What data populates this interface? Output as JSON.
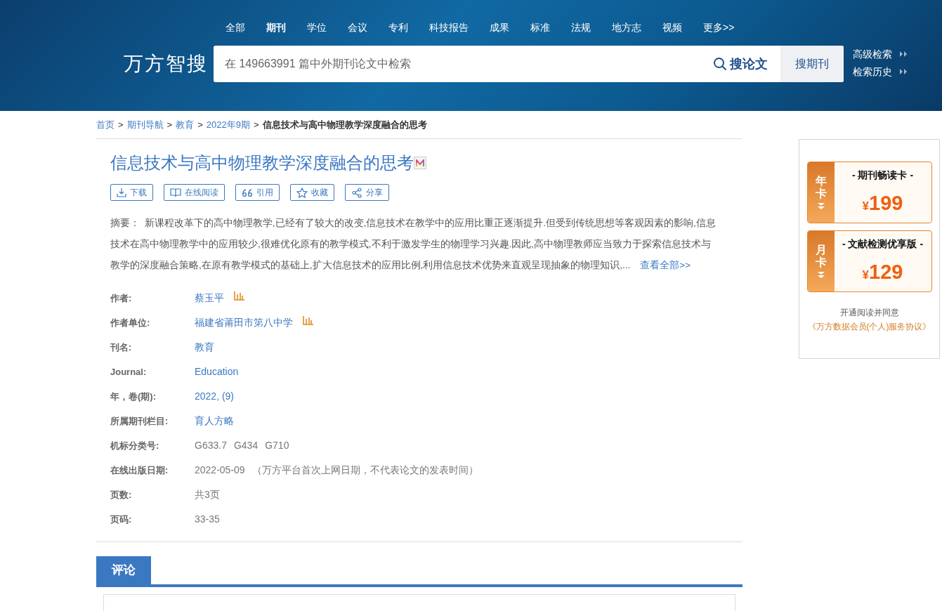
{
  "nav": [
    {
      "label": "全部",
      "selected": false
    },
    {
      "label": "期刊",
      "selected": true
    },
    {
      "label": "学位",
      "selected": false
    },
    {
      "label": "会议",
      "selected": false
    },
    {
      "label": "专利",
      "selected": false
    },
    {
      "label": "科技报告",
      "selected": false
    },
    {
      "label": "成果",
      "selected": false
    },
    {
      "label": "标准",
      "selected": false
    },
    {
      "label": "法规",
      "selected": false
    },
    {
      "label": "地方志",
      "selected": false
    },
    {
      "label": "视频",
      "selected": false
    },
    {
      "label": "更多>>",
      "selected": false
    }
  ],
  "logo": "万方智搜",
  "search": {
    "placeholder": "在 149663991 篇中外期刊论文中检索",
    "primary_button": "搜论文",
    "secondary_button": "搜期刊"
  },
  "side_links": [
    "高级检索",
    "检索历史"
  ],
  "breadcrumb_separator": ">",
  "breadcrumb": [
    {
      "label": "首页",
      "current": false
    },
    {
      "label": "期刊导航",
      "current": false
    },
    {
      "label": "教育",
      "current": false
    },
    {
      "label": "2022年9期",
      "current": false
    },
    {
      "label": "信息技术与高中物理教学深度融合的思考",
      "current": true
    }
  ],
  "title": "信息技术与高中物理教学深度融合的思考",
  "actions": [
    {
      "kind": "download",
      "label": "下载"
    },
    {
      "kind": "read",
      "label": "在线阅读"
    },
    {
      "kind": "cite",
      "label": "引用"
    },
    {
      "kind": "favorite",
      "label": "收藏"
    },
    {
      "kind": "share",
      "label": "分享"
    }
  ],
  "abstract": {
    "label": "摘要：",
    "text": "新课程改革下的高中物理教学,已经有了较大的改变,信息技术在教学中的应用比重正逐渐提升.但受到传统思想等客观因素的影响,信息技术在高中物理教学中的应用较少,很难优化原有的教学模式,不利于激发学生的物理学习兴趣.因此,高中物理教师应当致力于探索信息技术与教学的深度融合策略,在原有教学模式的基础上,扩大信息技术的应用比例,利用信息技术优势来直观呈现抽象的物理知识,...",
    "more": "查看全部>>"
  },
  "fields": [
    {
      "label": "作者:",
      "kind": "link",
      "values": [
        "蔡玉平"
      ],
      "stats": true
    },
    {
      "label": "作者单位:",
      "kind": "link",
      "values": [
        "福建省莆田市第八中学"
      ],
      "stats": true
    },
    {
      "label": "刊名:",
      "kind": "link",
      "values": [
        "教育"
      ],
      "stats": false
    },
    {
      "label": "Journal:",
      "kind": "link",
      "values": [
        "Education"
      ],
      "stats": false
    },
    {
      "label": "年，卷(期):",
      "kind": "link",
      "values": [
        "2022, (9)"
      ],
      "stats": false
    },
    {
      "label": "所属期刊栏目:",
      "kind": "link",
      "values": [
        "育人方略"
      ],
      "stats": false
    },
    {
      "label": "机标分类号:",
      "kind": "text",
      "values": [
        "G633.7",
        "G434",
        "G710"
      ],
      "stats": false
    },
    {
      "label": "在线出版日期:",
      "kind": "text",
      "values": [
        "2022-05-09",
        "（万方平台首次上网日期，不代表论文的发表时间）"
      ],
      "stats": false
    },
    {
      "label": "页数:",
      "kind": "text",
      "values": [
        "共3页"
      ],
      "stats": false
    },
    {
      "label": "页码:",
      "kind": "text",
      "values": [
        "33-35"
      ],
      "stats": false
    }
  ],
  "comment_tab": "评论",
  "offers": [
    {
      "tag": "年卡",
      "name": "- 期刊畅读卡 -",
      "currency": "¥",
      "price": "199"
    },
    {
      "tag": "月卡",
      "name": "- 文献检测优享版 -",
      "currency": "¥",
      "price": "129"
    }
  ],
  "agreement": {
    "text": "开通阅读并同意",
    "link": "《万方数据会员(个人)服务协议》"
  }
}
